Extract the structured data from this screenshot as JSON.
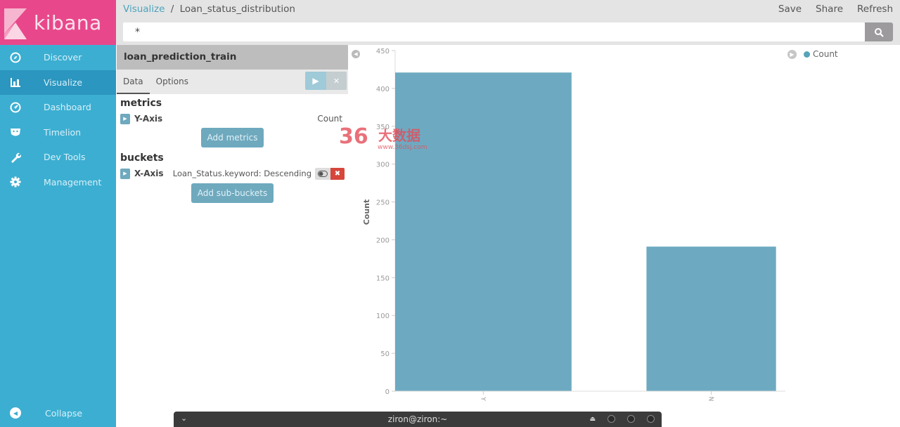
{
  "app": {
    "logo_text": "kibana"
  },
  "sidebar": {
    "items": [
      {
        "label": "Discover",
        "icon": "compass-icon"
      },
      {
        "label": "Visualize",
        "icon": "bar-chart-icon",
        "active": true
      },
      {
        "label": "Dashboard",
        "icon": "dashboard-gauge-icon"
      },
      {
        "label": "Timelion",
        "icon": "timelion-face-icon"
      },
      {
        "label": "Dev Tools",
        "icon": "wrench-icon"
      },
      {
        "label": "Management",
        "icon": "gear-icon"
      }
    ],
    "collapse_label": "Collapse"
  },
  "header": {
    "breadcrumb_root": "Visualize",
    "breadcrumb_sep": "/",
    "breadcrumb_current": "Loan_status_distribution",
    "actions": [
      "Save",
      "Share",
      "Refresh"
    ],
    "query_value": "*"
  },
  "panel": {
    "index_name": "loan_prediction_train",
    "tabs": [
      "Data",
      "Options"
    ],
    "metrics_heading": "metrics",
    "y_axis_label": "Y-Axis",
    "y_axis_value": "Count",
    "add_metrics": "Add metrics",
    "buckets_heading": "buckets",
    "x_axis_label": "X-Axis",
    "x_axis_value": "Loan_Status.keyword: Descending",
    "add_sub_buckets": "Add sub-buckets"
  },
  "legend": {
    "label": "Count",
    "color": "#57a3b8"
  },
  "watermark": {
    "num": "36",
    "cn": "大数据",
    "url": "www.36dsj.com"
  },
  "taskbar": {
    "title": "ziron@ziron:~"
  },
  "colors": {
    "bar": "#6daac1",
    "sidebar": "#3caed2",
    "logo": "#e8488b"
  },
  "chart_data": {
    "type": "bar",
    "categories": [
      "Y",
      "N"
    ],
    "values": [
      421,
      191
    ],
    "title": "",
    "xlabel": "",
    "ylabel": "Count",
    "ylim": [
      0,
      450
    ],
    "yticks": [
      0,
      50,
      100,
      150,
      200,
      250,
      300,
      350,
      400,
      450
    ],
    "grid": false,
    "legend": "top-right"
  }
}
